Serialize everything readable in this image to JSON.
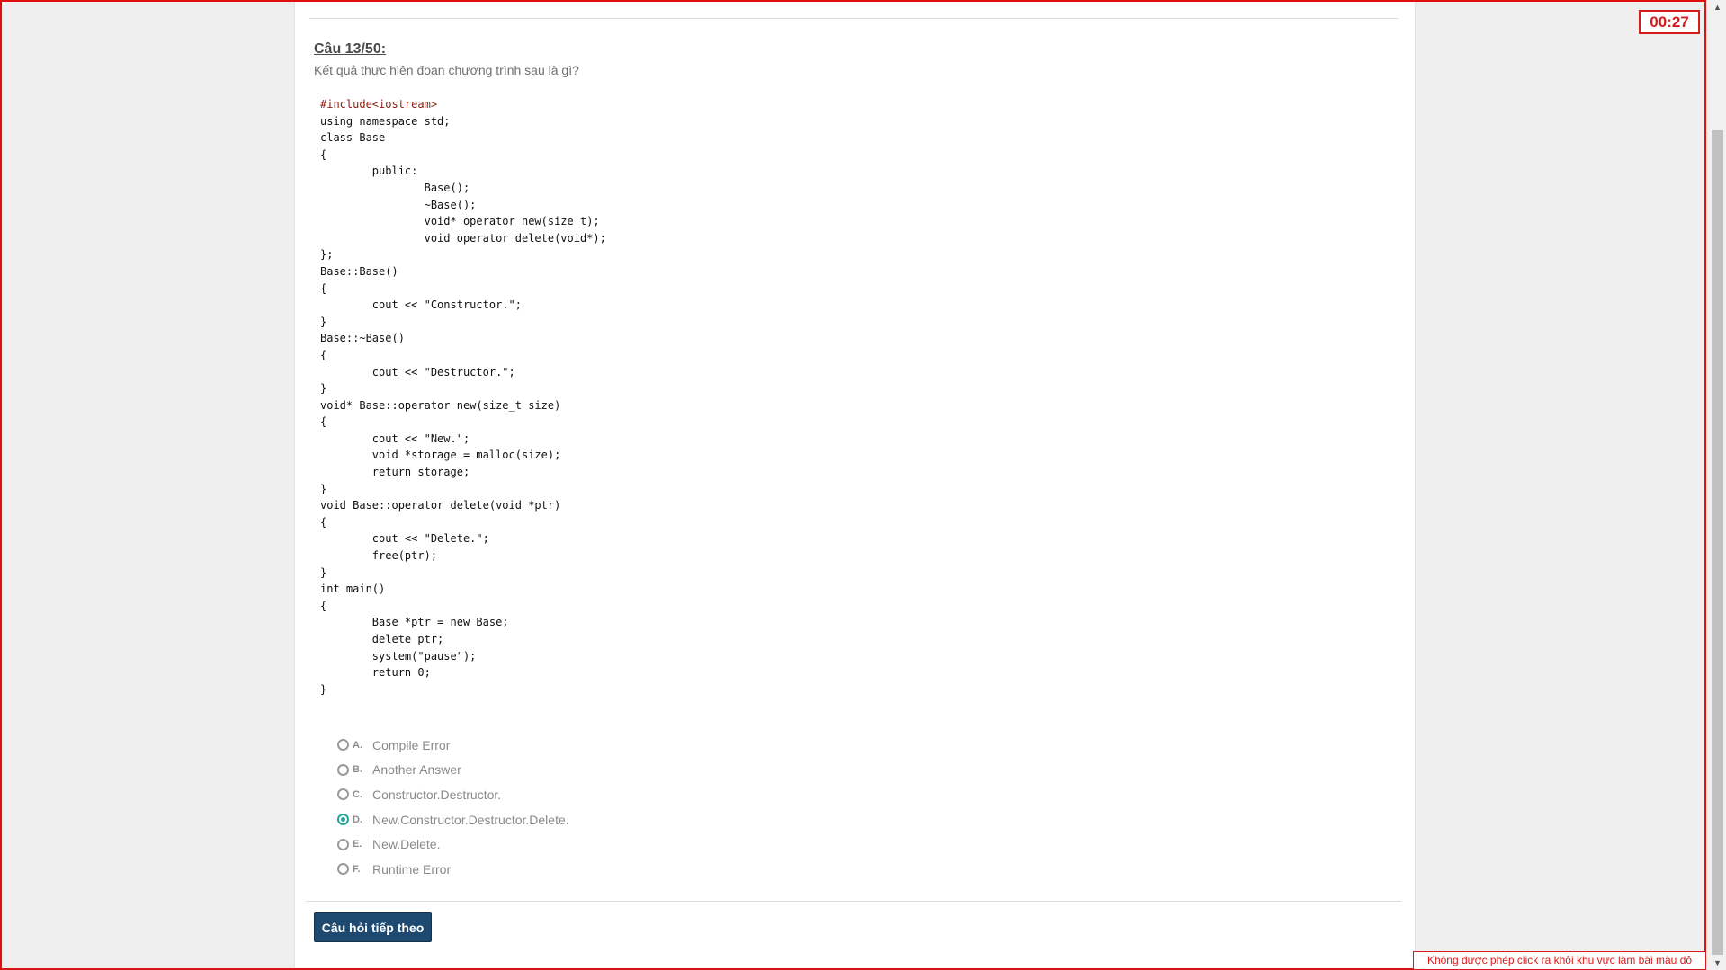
{
  "timer": {
    "value": "00:27"
  },
  "question": {
    "title": "Câu 13/50:",
    "text": "Kết quả thực hiện đoạn chương trình sau là gì?"
  },
  "code": [
    "#include<iostream>",
    "using namespace std;",
    "class Base",
    "{",
    "\tpublic:",
    "\t\tBase();",
    "\t\t~Base();",
    "\t\tvoid* operator new(size_t);",
    "\t\tvoid operator delete(void*);",
    "};",
    "Base::Base()",
    "{",
    "\tcout << \"Constructor.\";",
    "}",
    "Base::~Base()",
    "{",
    "\tcout << \"Destructor.\";",
    "}",
    "void* Base::operator new(size_t size)",
    "{",
    "\tcout << \"New.\";",
    "\tvoid *storage = malloc(size);",
    "\treturn storage;",
    "}",
    "void Base::operator delete(void *ptr)",
    "{",
    "\tcout << \"Delete.\";",
    "\tfree(ptr);",
    "}",
    "int main()",
    "{",
    "\tBase *ptr = new Base;",
    "\tdelete ptr;",
    "\tsystem(\"pause\");",
    "\treturn 0;",
    "}"
  ],
  "options": [
    {
      "letter": "A.",
      "text": "Compile Error",
      "checked": false
    },
    {
      "letter": "B.",
      "text": "Another Answer",
      "checked": false
    },
    {
      "letter": "C.",
      "text": "Constructor.Destructor.",
      "checked": false
    },
    {
      "letter": "D.",
      "text": "New.Constructor.Destructor.Delete.",
      "checked": true
    },
    {
      "letter": "E.",
      "text": "New.Delete.",
      "checked": false
    },
    {
      "letter": "F.",
      "text": "Runtime Error",
      "checked": false
    }
  ],
  "next_button": {
    "label": "Câu hỏi tiếp theo"
  },
  "warning": {
    "text": "Không được phép click ra khỏi khu vực làm bài màu đỏ"
  },
  "colors": {
    "accent_red": "#d61c1c",
    "radio_checked": "#26a69a",
    "button_bg": "#1e4a72"
  }
}
